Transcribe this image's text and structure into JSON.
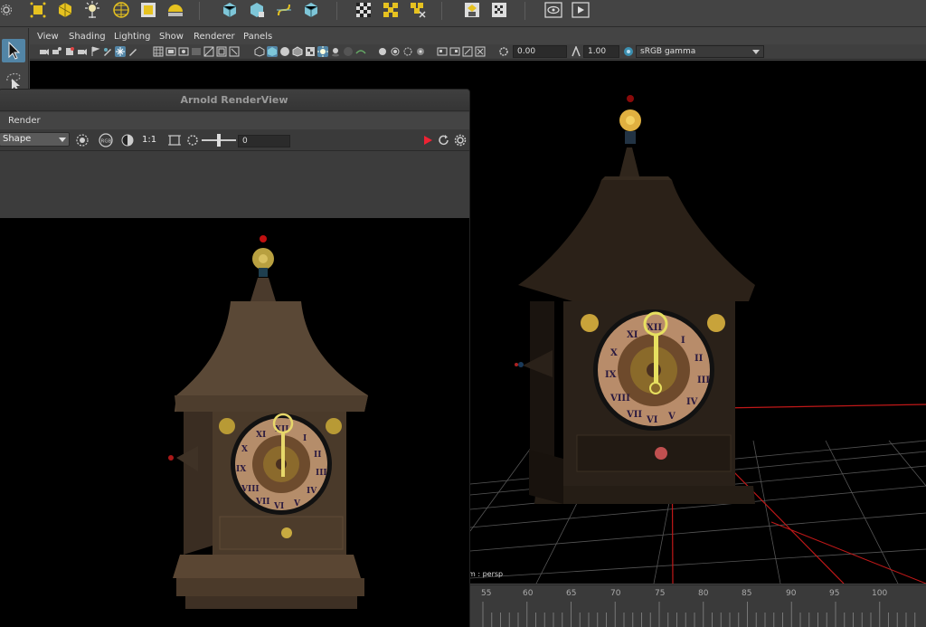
{
  "viewport": {
    "menu": [
      "View",
      "Shading",
      "Lighting",
      "Show",
      "Renderer",
      "Panels"
    ],
    "exposure": "0.00",
    "gamma": "1.00",
    "colorspace": "sRGB gamma",
    "camera_label": "m : persp"
  },
  "timeline": {
    "ticks": [
      "55",
      "60",
      "65",
      "70",
      "75",
      "80",
      "85",
      "90",
      "95",
      "100"
    ]
  },
  "renderview": {
    "title": "Arnold RenderView",
    "menu": "Render",
    "selection": "Shape",
    "ratio": "1:1",
    "exposure": "0"
  }
}
